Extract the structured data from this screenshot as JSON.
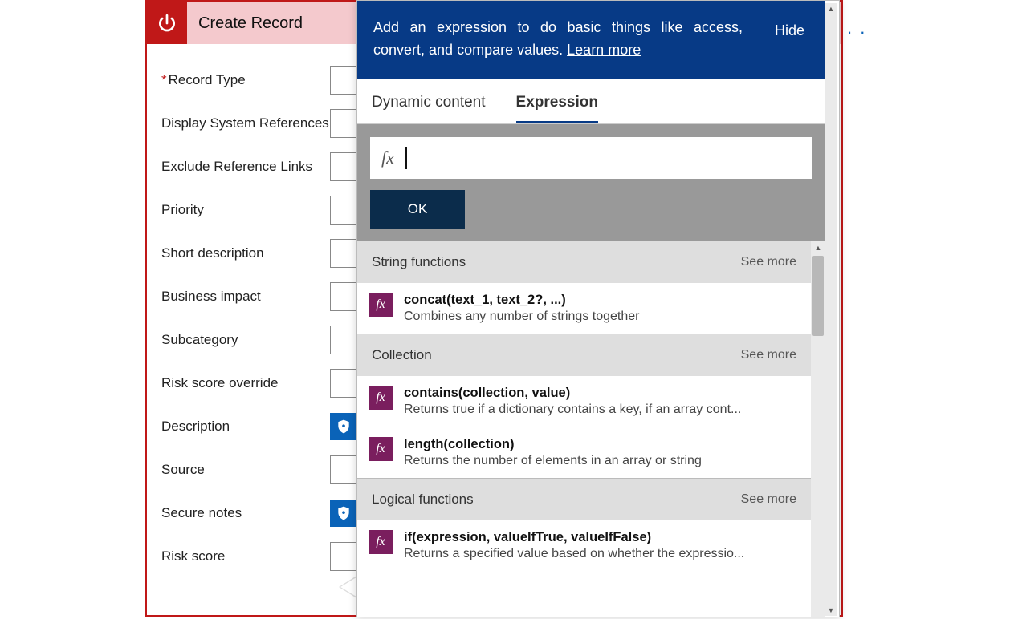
{
  "card": {
    "title": "Create Record",
    "fields": [
      {
        "label": "Record Type",
        "required": true,
        "shield": false
      },
      {
        "label": "Display System References",
        "required": false,
        "shield": false
      },
      {
        "label": "Exclude Reference Links",
        "required": false,
        "shield": false
      },
      {
        "label": "Priority",
        "required": false,
        "shield": false
      },
      {
        "label": "Short description",
        "required": false,
        "shield": false
      },
      {
        "label": "Business impact",
        "required": false,
        "shield": false
      },
      {
        "label": "Subcategory",
        "required": false,
        "shield": false
      },
      {
        "label": "Risk score override",
        "required": false,
        "shield": false
      },
      {
        "label": "Description",
        "required": false,
        "shield": true
      },
      {
        "label": "Source",
        "required": false,
        "shield": false
      },
      {
        "label": "Secure notes",
        "required": false,
        "shield": true
      },
      {
        "label": "Risk score",
        "required": false,
        "shield": false
      }
    ]
  },
  "popup": {
    "banner_text": "Add an expression to do basic things like access, convert, and compare values.",
    "learn_more": "Learn more",
    "hide": "Hide",
    "tabs": {
      "dynamic": "Dynamic content",
      "expression": "Expression",
      "active": "expression"
    },
    "fx_label": "fx",
    "ok": "OK",
    "see_more": "See more",
    "categories": [
      {
        "name": "String functions",
        "items": [
          {
            "sig": "concat(text_1, text_2?, ...)",
            "desc": "Combines any number of strings together"
          }
        ]
      },
      {
        "name": "Collection",
        "items": [
          {
            "sig": "contains(collection, value)",
            "desc": "Returns true if a dictionary contains a key, if an array cont..."
          },
          {
            "sig": "length(collection)",
            "desc": "Returns the number of elements in an array or string"
          }
        ]
      },
      {
        "name": "Logical functions",
        "items": [
          {
            "sig": "if(expression, valueIfTrue, valueIfFalse)",
            "desc": "Returns a specified value based on whether the expressio..."
          }
        ]
      }
    ]
  }
}
